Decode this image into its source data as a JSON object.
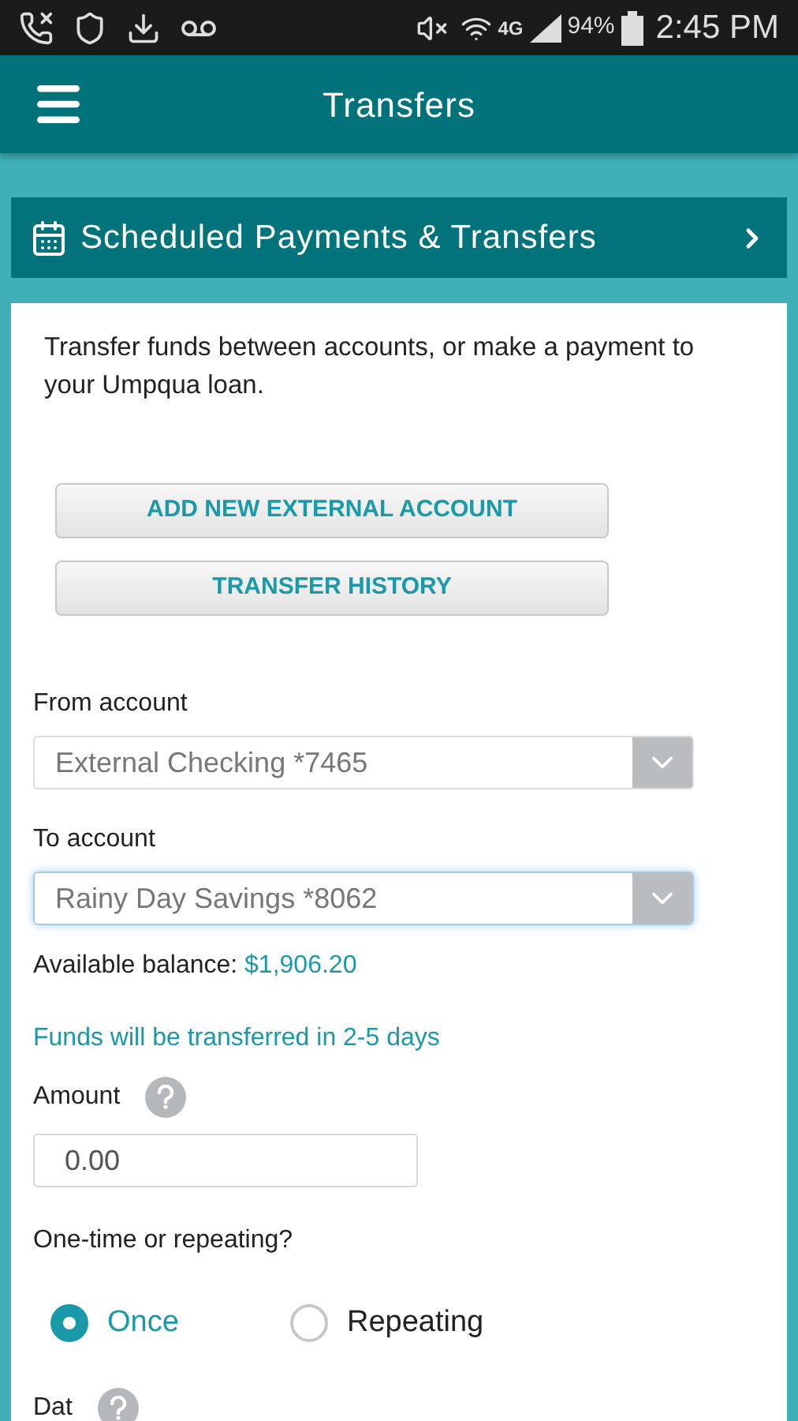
{
  "status_bar": {
    "network": "4G",
    "battery": "94%",
    "time": "2:45 PM"
  },
  "app_bar": {
    "title": "Transfers"
  },
  "scheduled_link": {
    "label": "Scheduled Payments & Transfers"
  },
  "intro": "Transfer funds between accounts, or make a payment to your Umpqua loan.",
  "buttons": [
    "ADD NEW EXTERNAL ACCOUNT",
    "TRANSFER HISTORY"
  ],
  "from_account": {
    "label": "From account",
    "value": "External Checking *7465",
    "focused": false
  },
  "to_account": {
    "label": "To account",
    "value": "Rainy Day Savings *8062",
    "focused": true
  },
  "balance": {
    "label": "Available balance:",
    "amount": "$1,906.20"
  },
  "notice": "Funds will be transferred in 2-5 days",
  "amount": {
    "label": "Amount",
    "value": "0.00"
  },
  "frequency": {
    "label": "One-time or repeating?",
    "options": [
      {
        "label": "Once",
        "selected": true
      },
      {
        "label": "Repeating",
        "selected": false
      }
    ]
  },
  "date": {
    "label": "Dat"
  }
}
